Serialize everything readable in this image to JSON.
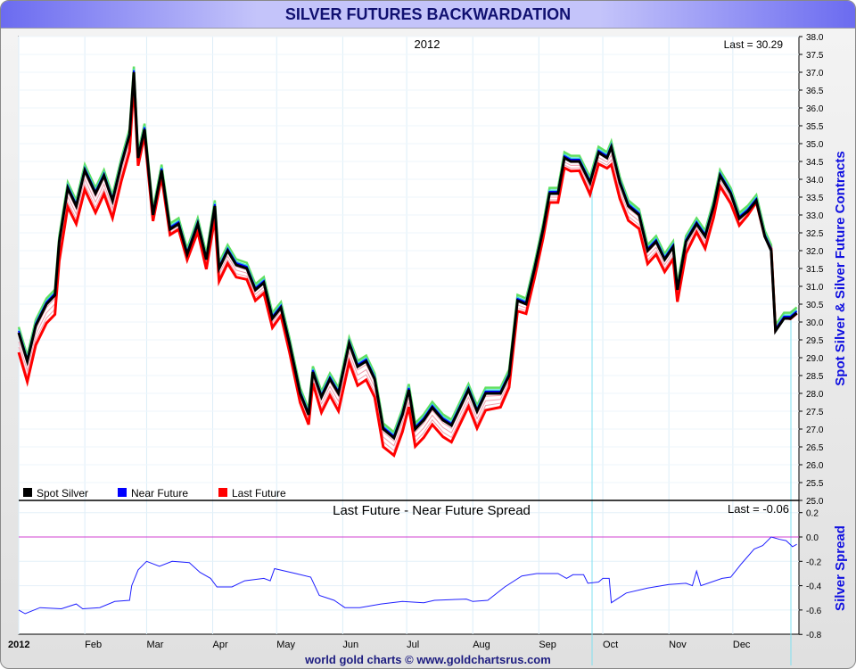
{
  "header": {
    "title": "SILVER FUTURES BACKWARDATION"
  },
  "footer": "world gold charts © www.goldchartsrus.com",
  "chart_data": [
    {
      "type": "line",
      "title": "2012",
      "last_label": "Last = 30.29",
      "ylabel": "Spot Silver & Silver Future Contracts",
      "ylim": [
        25,
        38
      ],
      "yticks": [
        "38.0",
        "37.5",
        "37.0",
        "36.5",
        "36.0",
        "35.5",
        "35.0",
        "34.5",
        "34.0",
        "33.5",
        "33.0",
        "32.5",
        "32.0",
        "31.5",
        "31.0",
        "30.5",
        "30.0",
        "29.5",
        "29.0",
        "28.5",
        "28.0",
        "27.5",
        "27.0",
        "26.5",
        "26.0",
        "25.5",
        "25.0"
      ],
      "legend": [
        {
          "name": "Spot Silver",
          "color": "#000000"
        },
        {
          "name": "Near Future",
          "color": "#0000ff"
        },
        {
          "name": "Last Future",
          "color": "#ff0000"
        }
      ],
      "legend_position": "bottom-left",
      "spot": {
        "day": [
          0,
          4,
          8,
          13,
          17,
          19,
          23,
          27,
          31,
          36,
          40,
          44,
          48,
          52,
          54,
          56,
          59,
          63,
          67,
          71,
          75,
          79,
          84,
          88,
          92,
          94,
          98,
          102,
          107,
          111,
          115,
          119,
          123,
          127,
          132,
          136,
          138,
          142,
          146,
          150,
          155,
          159,
          163,
          167,
          171,
          176,
          180,
          183,
          186,
          190,
          194,
          199,
          203,
          207,
          211,
          215,
          219,
          226,
          230,
          234,
          238,
          242,
          246,
          249,
          253,
          256,
          259,
          263,
          268,
          272,
          276,
          278,
          282,
          286,
          291,
          295,
          299,
          303,
          307,
          309,
          313,
          318,
          322,
          326,
          329,
          334,
          338,
          342,
          346,
          350,
          353,
          355,
          359,
          362,
          365
        ],
        "value": [
          29.7,
          28.9,
          29.9,
          30.5,
          30.75,
          32.25,
          33.75,
          33.25,
          34.25,
          33.6,
          34.1,
          33.4,
          34.4,
          35.25,
          37.0,
          34.6,
          35.4,
          33.0,
          34.25,
          32.6,
          32.75,
          31.9,
          32.75,
          31.75,
          33.25,
          31.5,
          32.0,
          31.6,
          31.5,
          30.9,
          31.1,
          30.1,
          30.4,
          29.4,
          28.0,
          27.4,
          28.6,
          27.9,
          28.4,
          28.0,
          29.4,
          28.75,
          28.9,
          28.4,
          27.0,
          26.75,
          27.4,
          28.1,
          27.0,
          27.25,
          27.6,
          27.25,
          27.1,
          27.6,
          28.1,
          27.5,
          28.0,
          28.0,
          28.5,
          30.6,
          30.5,
          31.5,
          32.6,
          33.6,
          33.6,
          34.6,
          34.5,
          34.5,
          33.9,
          34.75,
          34.6,
          34.9,
          33.9,
          33.25,
          33.0,
          32.0,
          32.25,
          31.75,
          32.1,
          30.9,
          32.25,
          32.75,
          32.4,
          33.25,
          34.1,
          33.6,
          32.9,
          33.1,
          33.4,
          32.4,
          32.0,
          29.75,
          30.1,
          30.1,
          30.25
        ]
      }
    },
    {
      "type": "line",
      "title": "Last Future - Near Future Spread",
      "last_label": "Last = -0.06",
      "ylabel": "Silver Spread",
      "ylim": [
        -0.8,
        0.2
      ],
      "yticks": [
        "0.2",
        "0.0",
        "-0.2",
        "-0.4",
        "-0.6",
        "-0.8"
      ],
      "xticks": [
        "2012",
        "Feb",
        "Mar",
        "Apr",
        "May",
        "Jun",
        "Jul",
        "Aug",
        "Sep",
        "Oct",
        "Nov",
        "Dec"
      ],
      "spread": {
        "day": [
          0,
          3,
          10,
          20,
          27,
          30,
          38,
          45,
          52,
          53,
          56,
          60,
          66,
          72,
          80,
          85,
          90,
          93,
          100,
          106,
          115,
          118,
          120,
          130,
          137,
          141,
          148,
          153,
          160,
          170,
          180,
          190,
          195,
          210,
          213,
          220,
          228,
          236,
          243,
          253,
          257,
          260,
          265,
          267,
          272,
          274,
          277,
          278,
          285,
          295,
          305,
          313,
          316,
          318,
          320,
          330,
          334,
          339,
          345,
          349,
          353,
          357,
          360,
          363,
          365
        ],
        "value": [
          -0.6,
          -0.63,
          -0.58,
          -0.59,
          -0.55,
          -0.59,
          -0.58,
          -0.53,
          -0.52,
          -0.4,
          -0.27,
          -0.2,
          -0.24,
          -0.2,
          -0.21,
          -0.29,
          -0.34,
          -0.41,
          -0.41,
          -0.36,
          -0.34,
          -0.36,
          -0.26,
          -0.3,
          -0.33,
          -0.48,
          -0.52,
          -0.58,
          -0.58,
          -0.55,
          -0.53,
          -0.54,
          -0.52,
          -0.51,
          -0.53,
          -0.52,
          -0.41,
          -0.32,
          -0.3,
          -0.3,
          -0.34,
          -0.31,
          -0.31,
          -0.38,
          -0.37,
          -0.34,
          -0.34,
          -0.54,
          -0.46,
          -0.42,
          -0.39,
          -0.38,
          -0.4,
          -0.28,
          -0.4,
          -0.34,
          -0.33,
          -0.22,
          -0.1,
          -0.07,
          0.0,
          -0.02,
          -0.03,
          -0.08,
          -0.06
        ]
      }
    }
  ]
}
